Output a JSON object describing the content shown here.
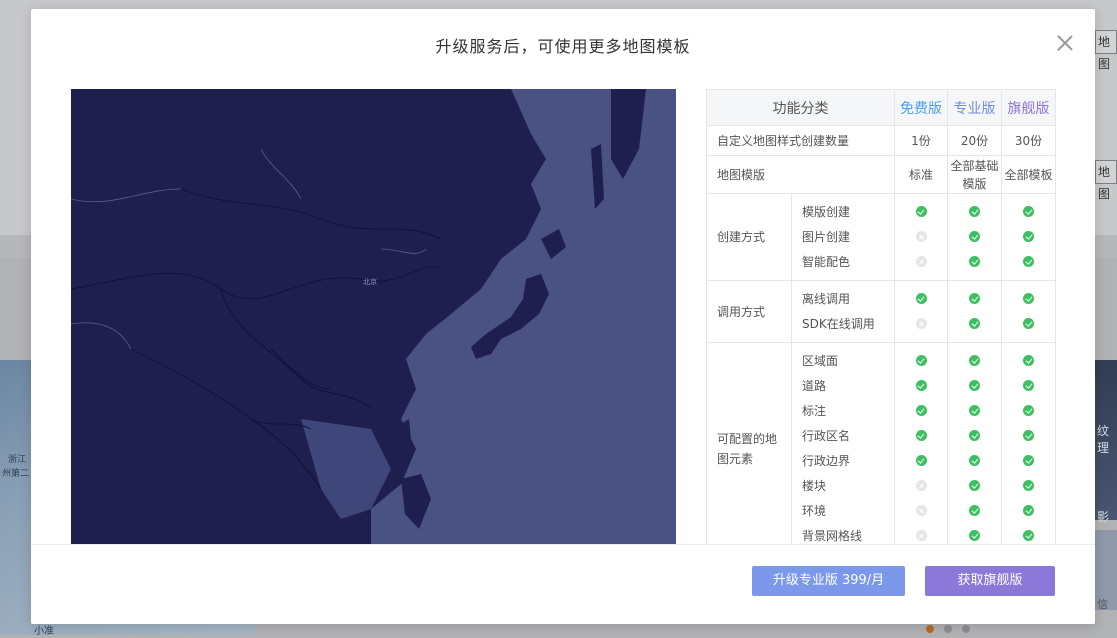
{
  "background": {
    "right_tab_label": "地图",
    "left_text_1": "浙江",
    "left_text_2": "州第二",
    "left_text_3": "小准",
    "right_text_1": "纹理",
    "right_text_2": "影",
    "right_text_3": "信"
  },
  "modal": {
    "title": "升级服务后，可使用更多地图模板",
    "map_label": "北京"
  },
  "table": {
    "headers": {
      "category": "功能分类",
      "free": "免费版",
      "pro": "专业版",
      "flagship": "旗舰版"
    },
    "rows": {
      "custom_count": {
        "label": "自定义地图样式创建数量",
        "free": "1份",
        "pro": "20份",
        "flagship": "30份"
      },
      "templates": {
        "label": "地图模版",
        "free": "标准",
        "pro": "全部基础模版",
        "flagship": "全部模板"
      }
    },
    "groups": [
      {
        "title": "创建方式",
        "items": [
          {
            "name": "模版创建",
            "free": true,
            "pro": true,
            "flagship": true
          },
          {
            "name": "图片创建",
            "free": false,
            "pro": true,
            "flagship": true
          },
          {
            "name": "智能配色",
            "free": false,
            "pro": true,
            "flagship": true
          }
        ]
      },
      {
        "title": "调用方式",
        "items": [
          {
            "name": "离线调用",
            "free": true,
            "pro": true,
            "flagship": true
          },
          {
            "name": "SDK在线调用",
            "free": false,
            "pro": true,
            "flagship": true
          }
        ]
      },
      {
        "title": "可配置的地图元素",
        "items": [
          {
            "name": "区域面",
            "free": true,
            "pro": true,
            "flagship": true
          },
          {
            "name": "道路",
            "free": true,
            "pro": true,
            "flagship": true
          },
          {
            "name": "标注",
            "free": true,
            "pro": true,
            "flagship": true
          },
          {
            "name": "行政区名",
            "free": true,
            "pro": true,
            "flagship": true
          },
          {
            "name": "行政边界",
            "free": true,
            "pro": true,
            "flagship": true
          },
          {
            "name": "楼块",
            "free": false,
            "pro": true,
            "flagship": true
          },
          {
            "name": "环境",
            "free": false,
            "pro": true,
            "flagship": true
          },
          {
            "name": "背景网格线",
            "free": false,
            "pro": true,
            "flagship": true
          }
        ]
      }
    ]
  },
  "footer": {
    "upgrade_pro_label": "升级专业版 399/月",
    "get_flagship_label": "获取旗舰版"
  },
  "colors": {
    "free": "#4a9ff5",
    "pro": "#6e8de5",
    "flagship": "#8e76d8",
    "check": "#3cc060",
    "map_land": "#1f1f4f",
    "map_sea": "#4a5183"
  }
}
